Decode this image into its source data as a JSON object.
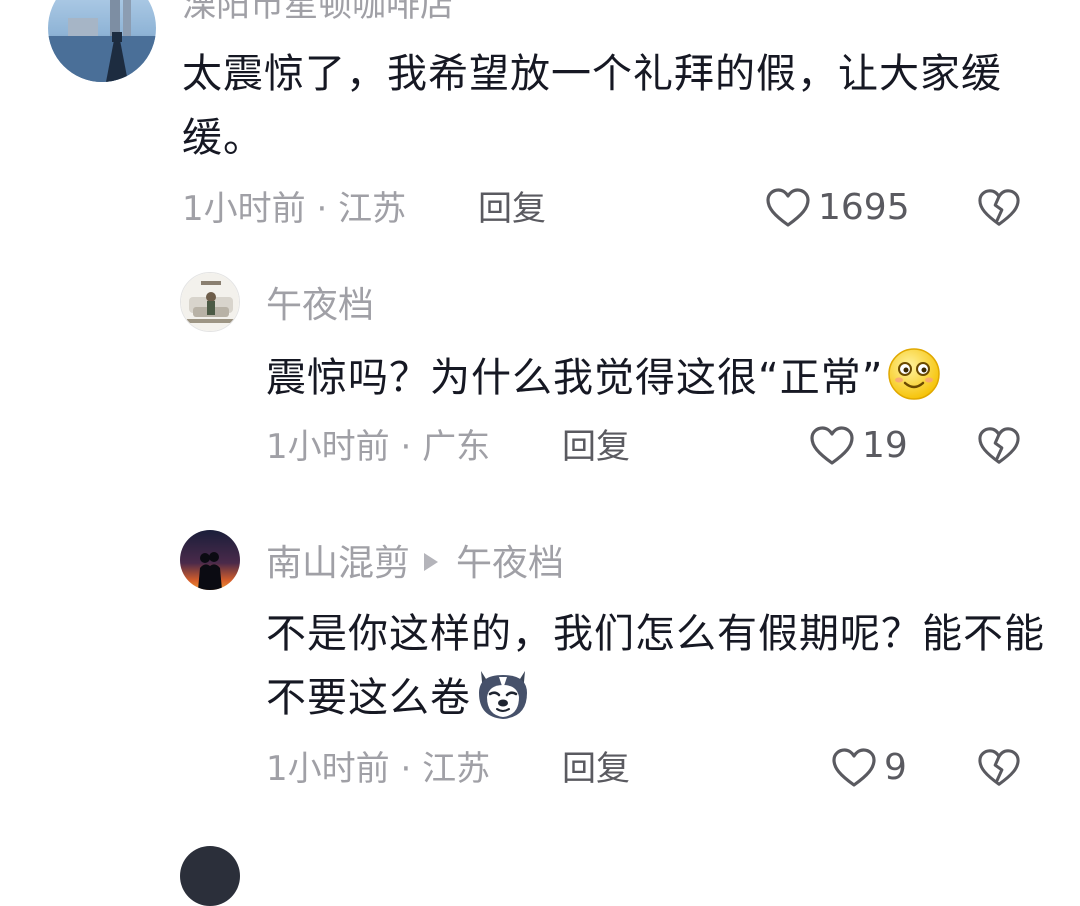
{
  "comments": [
    {
      "author": "溧阳市星顿咖啡店",
      "text": "太震惊了，我希望放一个礼拜的假，让大家缓缓。",
      "time": "1小时前",
      "location": "江苏",
      "reply_label": "回复",
      "likes": "1695"
    },
    {
      "author": "午夜档",
      "text": "震惊吗？为什么我觉得这很“正常”",
      "emoji": "smile-emoji",
      "time": "1小时前",
      "location": "广东",
      "reply_label": "回复",
      "likes": "19"
    },
    {
      "author": "南山混剪",
      "reply_to": "午夜档",
      "text": "不是你这样的，我们怎么有假期呢？能不能不要这么卷",
      "emoji": "husky-emoji",
      "time": "1小时前",
      "location": "江苏",
      "reply_label": "回复",
      "likes": "9"
    }
  ],
  "icons": {
    "like": "heart-outline-icon",
    "dislike": "broken-heart-icon"
  },
  "colors": {
    "text": "#161823",
    "secondary": "#a0a0a6",
    "action": "#5a5a60"
  }
}
